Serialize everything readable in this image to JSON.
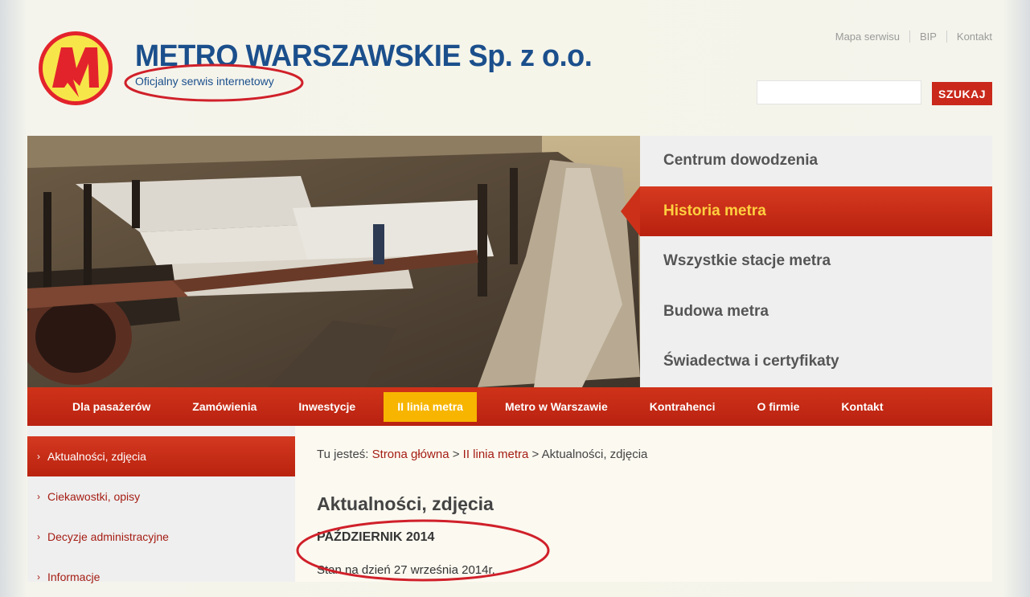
{
  "brand": {
    "title": "METRO WARSZAWSKIE Sp. z o.o.",
    "subtitle": "Oficjalny serwis internetowy",
    "logo_letter": "M"
  },
  "top_links": [
    "Mapa serwisu",
    "BIP",
    "Kontakt"
  ],
  "search": {
    "placeholder": "",
    "value": "",
    "button_label": "SZUKAJ"
  },
  "side_menu": {
    "items": [
      {
        "label": "Centrum dowodzenia"
      },
      {
        "label": "Historia metra",
        "active": true
      },
      {
        "label": "Wszystkie stacje metra"
      },
      {
        "label": "Budowa metra"
      },
      {
        "label": "Świadectwa i certyfikaty"
      }
    ]
  },
  "main_nav": {
    "items": [
      {
        "label": "Dla pasażerów"
      },
      {
        "label": "Zamówienia"
      },
      {
        "label": "Inwestycje"
      },
      {
        "label": "II linia metra",
        "active": true
      },
      {
        "label": "Metro w Warszawie"
      },
      {
        "label": "Kontrahenci"
      },
      {
        "label": "O firmie"
      },
      {
        "label": "Kontakt"
      }
    ]
  },
  "left_menu": {
    "items": [
      {
        "label": "Aktualności, zdjęcia",
        "active": true
      },
      {
        "label": "Ciekawostki, opisy"
      },
      {
        "label": "Decyzje administracyjne"
      },
      {
        "label": "Informacje"
      }
    ]
  },
  "breadcrumb": {
    "prefix": "Tu jesteś:",
    "home": "Strona główna",
    "sep1": ">",
    "section": "II linia metra",
    "sep2": ">",
    "current": "Aktualności, zdjęcia"
  },
  "content": {
    "title": "Aktualności, zdjęcia",
    "subheading": "PAŹDZIERNIK 2014",
    "text": "Stan na dzień 27 września 2014r."
  },
  "colors": {
    "brand_blue": "#1b4f8c",
    "accent_red": "#c9281b",
    "active_yellow": "#f7b500",
    "link_red": "#a51d14",
    "annotation_red": "#d0202a"
  }
}
